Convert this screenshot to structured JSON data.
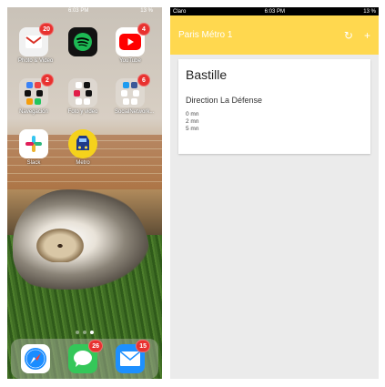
{
  "left_phone": {
    "status": {
      "time": "6:03 PM",
      "battery": "13 %"
    },
    "apps": [
      {
        "label": "Photo & Video",
        "badge": "20"
      },
      {
        "label": "",
        "badge": ""
      },
      {
        "label": "YouTube",
        "badge": "4"
      },
      {
        "label": "Navegación",
        "badge": "2"
      },
      {
        "label": "Foto y video",
        "badge": ""
      },
      {
        "label": "SocialNetwork...",
        "badge": "6"
      },
      {
        "label": "Slack",
        "badge": ""
      },
      {
        "label": "Metro",
        "badge": ""
      }
    ],
    "dock": [
      {
        "name": "safari",
        "badge": ""
      },
      {
        "name": "messages",
        "badge": "26"
      },
      {
        "name": "mail",
        "badge": "15"
      }
    ]
  },
  "right_phone": {
    "status": {
      "carrier": "Claro",
      "time": "6:03 PM",
      "battery": "13 %"
    },
    "appbar": {
      "title": "Paris Métro 1",
      "refresh_icon": "↻",
      "add_icon": "+"
    },
    "card": {
      "station": "Bastille",
      "direction": "Direction La Défense",
      "times": [
        "0 mn",
        "2 mn",
        "5 mn"
      ]
    }
  },
  "colors": {
    "appbar": "#ffd84f",
    "badge": "#e8312f",
    "background": "#ebebeb"
  }
}
